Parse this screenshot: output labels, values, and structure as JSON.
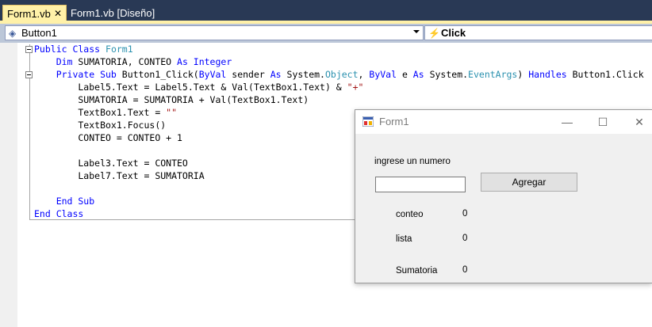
{
  "tabs": [
    {
      "label": "Form1.vb",
      "close": "✕"
    },
    {
      "label": "Form1.vb [Diseño]"
    }
  ],
  "navbar": {
    "object_selector": "Button1",
    "event_selector": "Click"
  },
  "code_lines": [
    {
      "tokens": [
        {
          "t": "Public Class ",
          "c": "kw"
        },
        {
          "t": "Form1",
          "c": "ty"
        }
      ]
    },
    {
      "tokens": [
        {
          "t": "    Dim ",
          "c": "kw"
        },
        {
          "t": "SUMATORIA, CONTEO "
        },
        {
          "t": "As Integer",
          "c": "kw"
        }
      ]
    },
    {
      "tokens": [
        {
          "t": "    Private Sub ",
          "c": "kw"
        },
        {
          "t": "Button1_Click("
        },
        {
          "t": "ByVal",
          "c": "kw"
        },
        {
          "t": " sender "
        },
        {
          "t": "As",
          "c": "kw"
        },
        {
          "t": " System."
        },
        {
          "t": "Object",
          "c": "ty"
        },
        {
          "t": ", "
        },
        {
          "t": "ByVal",
          "c": "kw"
        },
        {
          "t": " e "
        },
        {
          "t": "As",
          "c": "kw"
        },
        {
          "t": " System."
        },
        {
          "t": "EventArgs",
          "c": "ty"
        },
        {
          "t": ") "
        },
        {
          "t": "Handles",
          "c": "kw"
        },
        {
          "t": " Button1.Click"
        }
      ]
    },
    {
      "tokens": [
        {
          "t": "        Label5.Text = Label5.Text & Val(TextBox1.Text) & "
        },
        {
          "t": "\"+\"",
          "c": "st"
        }
      ]
    },
    {
      "tokens": [
        {
          "t": "        SUMATORIA = SUMATORIA + Val(TextBox1.Text)"
        }
      ]
    },
    {
      "tokens": [
        {
          "t": "        TextBox1.Text = "
        },
        {
          "t": "\"\"",
          "c": "st"
        }
      ]
    },
    {
      "tokens": [
        {
          "t": "        TextBox1.Focus()"
        }
      ]
    },
    {
      "tokens": [
        {
          "t": "        CONTEO = CONTEO + 1"
        }
      ]
    },
    {
      "tokens": []
    },
    {
      "tokens": [
        {
          "t": "        Label3.Text = CONTEO"
        }
      ]
    },
    {
      "tokens": [
        {
          "t": "        Label7.Text = SUMATORIA"
        }
      ]
    },
    {
      "tokens": []
    },
    {
      "tokens": [
        {
          "t": "    End Sub",
          "c": "kw"
        }
      ]
    },
    {
      "tokens": [
        {
          "t": "End Class",
          "c": "kw"
        }
      ]
    }
  ],
  "form": {
    "title": "Form1",
    "minimize": "—",
    "maximize": "☐",
    "close": "✕",
    "prompt_label": "ingrese un numero",
    "textbox_value": "",
    "button_label": "Agregar",
    "conteo_label": "conteo",
    "conteo_value": "0",
    "lista_label": "lista",
    "lista_value": "0",
    "sumatoria_label": "Sumatoria",
    "sumatoria_value": "0"
  },
  "colors": {
    "ide_background": "#293955",
    "active_tab": "#fff1a8",
    "keyword": "#0000ff",
    "type": "#2b91af",
    "string": "#a31515"
  }
}
